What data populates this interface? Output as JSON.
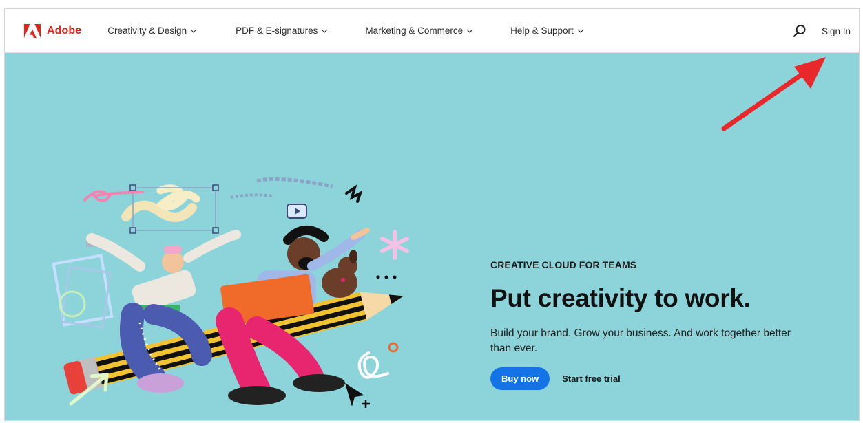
{
  "brand": {
    "name": "Adobe",
    "color": "#e1251b"
  },
  "nav": {
    "items": [
      {
        "label": "Creativity & Design",
        "icon": "chevron-down-icon"
      },
      {
        "label": "PDF & E-signatures",
        "icon": "chevron-down-icon"
      },
      {
        "label": "Marketing & Commerce",
        "icon": "chevron-down-icon"
      },
      {
        "label": "Help & Support",
        "icon": "chevron-down-icon"
      }
    ],
    "search_icon": "search-icon",
    "signin_label": "Sign In"
  },
  "hero": {
    "background": "#8cd3da",
    "eyebrow": "CREATIVE CLOUD FOR TEAMS",
    "headline": "Put creativity to work.",
    "body": "Build your brand. Grow your business. And work together better than ever.",
    "primary_cta": "Buy now",
    "secondary_cta": "Start free trial",
    "primary_color": "#1473e6"
  },
  "annotation": {
    "type": "red-arrow",
    "color": "#e8282b",
    "points_to": "Sign In"
  }
}
